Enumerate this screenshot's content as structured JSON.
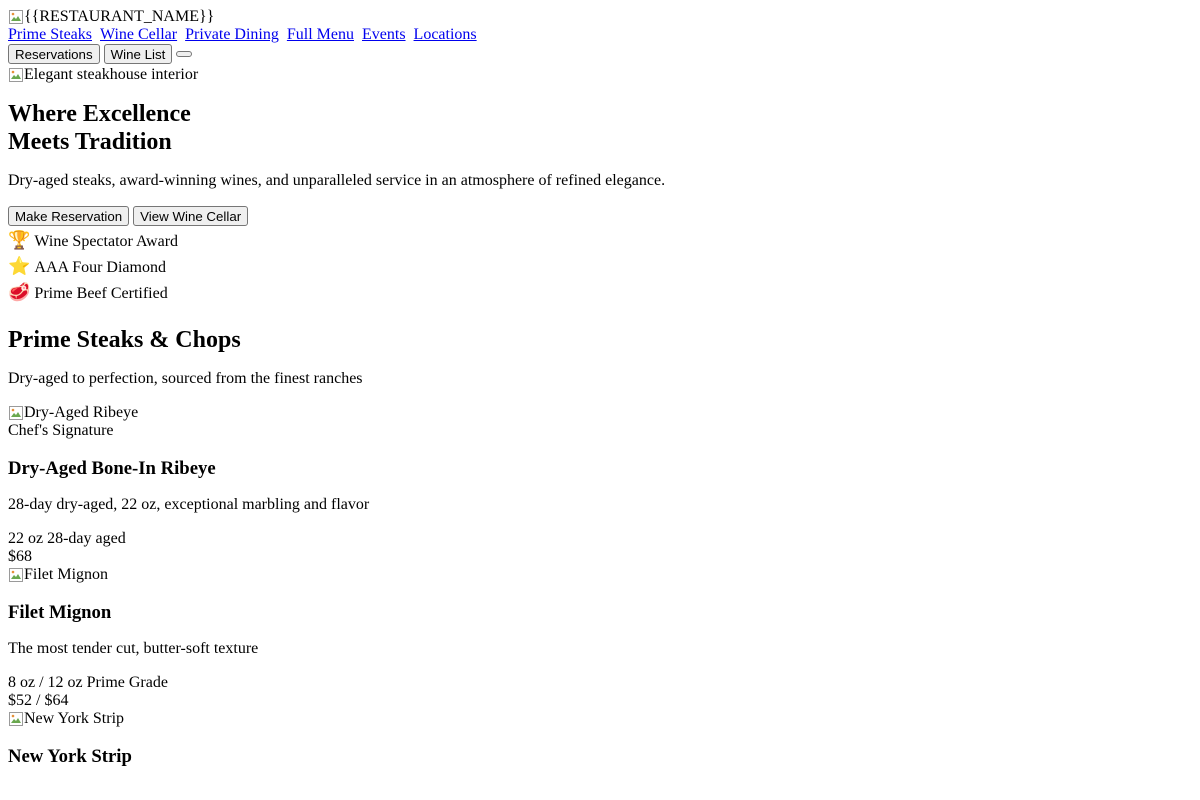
{
  "header": {
    "logo_alt": "{{RESTAURANT_NAME}}",
    "nav": [
      "Prime Steaks",
      "Wine Cellar",
      "Private Dining",
      "Full Menu",
      "Events",
      "Locations"
    ],
    "buttons": {
      "reservations": "Reservations",
      "wine_list": "Wine List",
      "menu_toggle": ""
    }
  },
  "hero": {
    "image_alt": "Elegant steakhouse interior",
    "title_line1": "Where Excellence",
    "title_line2": "Meets Tradition",
    "subtitle": "Dry-aged steaks, award-winning wines, and unparalleled service in an atmosphere of refined elegance.",
    "cta_primary": "Make Reservation",
    "cta_secondary": "View Wine Cellar"
  },
  "badges": [
    {
      "icon": "🏆",
      "icon_name": "trophy-icon",
      "label": "Wine Spectator Award"
    },
    {
      "icon": "⭐",
      "icon_name": "star-icon",
      "label": "AAA Four Diamond"
    },
    {
      "icon": "🥩",
      "icon_name": "steak-icon",
      "label": "Prime Beef Certified"
    }
  ],
  "menu_section": {
    "title": "Prime Steaks & Chops",
    "subtitle": "Dry-aged to perfection, sourced from the finest ranches",
    "items": [
      {
        "image_alt": "Dry-Aged Ribeye",
        "tag": "Chef's Signature",
        "name": "Dry-Aged Bone-In Ribeye",
        "description": "28-day dry-aged, 22 oz, exceptional marbling and flavor",
        "meta": "22 oz 28-day aged",
        "price": "$68"
      },
      {
        "image_alt": "Filet Mignon",
        "tag": "",
        "name": "Filet Mignon",
        "description": "The most tender cut, butter-soft texture",
        "meta": "8 oz / 12 oz Prime Grade",
        "price": "$52 / $64"
      },
      {
        "image_alt": "New York Strip",
        "tag": "",
        "name": "New York Strip",
        "description": "",
        "meta": "",
        "price": ""
      }
    ]
  }
}
